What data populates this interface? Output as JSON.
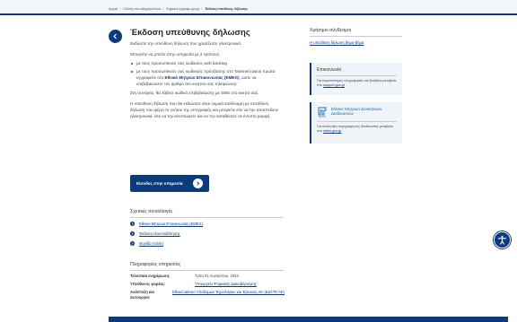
{
  "breadcrumb": {
    "items": [
      "Αρχική",
      "Πολίτης και καθημερινότητα",
      "Ψηφιακά έγγραφα gov.gr"
    ],
    "current": "Έκδοση υπεύθυνης δήλωσης"
  },
  "page": {
    "title": "Έκδοση υπεύθυνης δήλωσης",
    "lead": "Εκδώστε την υπεύθυνη δήλωση που χρειάζεστε ηλεκτρονικά.",
    "intro": "Μπορείτε να μπείτε στην υπηρεσία με 2 τρόπους:",
    "way1": "με τους προσωπικούς σας κωδικούς web banking",
    "way2_pre": "με τους προσωπικούς σας κωδικούς πρόσβασης στο Taxisnet (αφού πρώτα εγγραφείτε στο ",
    "way2_link": "Εθνικό Μητρώο Επικοινωνίας (ΕΜΕπ)",
    "way2_post": ", ώστε να επιβεβαιώσετε τον αριθμό του κινητού σας τηλεφώνου)",
    "after": "Στη συνέχεια, θα λάβετε κωδικό επιβεβαίωσης με SMS στο κινητό σας.",
    "info": "Η υπεύθυνη δήλωση που θα εκδώσετε είναι νομικά ισοδύναμη με υπεύθυνη δήλωση που φέρει το γνήσιο της υπογραφής και μπορείτε είτε να την αποστείλετε ηλεκτρονικά, είτε να την εκτυπώσετε και να την καταθέσετε σε έντυπη μορφή.",
    "cta_label": "Είσοδος στην υπηρεσία"
  },
  "related": {
    "title": "Σχετικές συναλλαγές",
    "items": [
      "Εθνικό Μητρώο Επικοινωνίας (ΕΜΕπ)",
      "Έκδοση εξουσιοδότησης",
      "Θυρίδα πολίτη"
    ]
  },
  "infos": {
    "title": "Πληροφορίες υπηρεσίας",
    "rows": [
      {
        "key": "Τελευταία ενημέρωση:",
        "value": "Τρίτη 01 Αυγούστου, 2023"
      },
      {
        "key": "Υπεύθυνος φορέας:",
        "value": "Υπουργείο Ψηφιακής Διακυβέρνησης"
      },
      {
        "key": "Ανάπτυξη και λειτουργία:",
        "value": "Εθνικό Δίκτυο Υποδομών Τεχνολογίας και Έρευνας ΑΕ (ΕΔΥΤΕ ΑΕ)"
      }
    ]
  },
  "sidebar": {
    "useful_title": "Χρήσιμοι σύνδεσμοι",
    "useful_link": "Η υπεύθυνη δήλωση βήμα-βήμα",
    "contact_title": "Επικοινωνία",
    "contact_text": "Για περισσότερες πληροφορίες και βοήθεια μεταβείτε στο ",
    "contact_link": "support.gov.gr",
    "mitos_word": "MITOS",
    "mitos_name": "Εθνικό Μητρώο Διοικητικών Διαδικασιών",
    "mitos_text": "Για αναλυτική περιγραφή της διαδικασίας μεταβείτε στο ",
    "mitos_link": "mitos.gov.gr"
  },
  "icons": {
    "back": "chevron-left-icon",
    "cta": "arrow-right-icon",
    "related": "chevron-right-icon",
    "accessibility": "accessibility-icon"
  },
  "colors": {
    "primary": "#0d3a7a",
    "card_bg": "#f0f3f7",
    "mitos_blue": "#1b6fb0"
  }
}
